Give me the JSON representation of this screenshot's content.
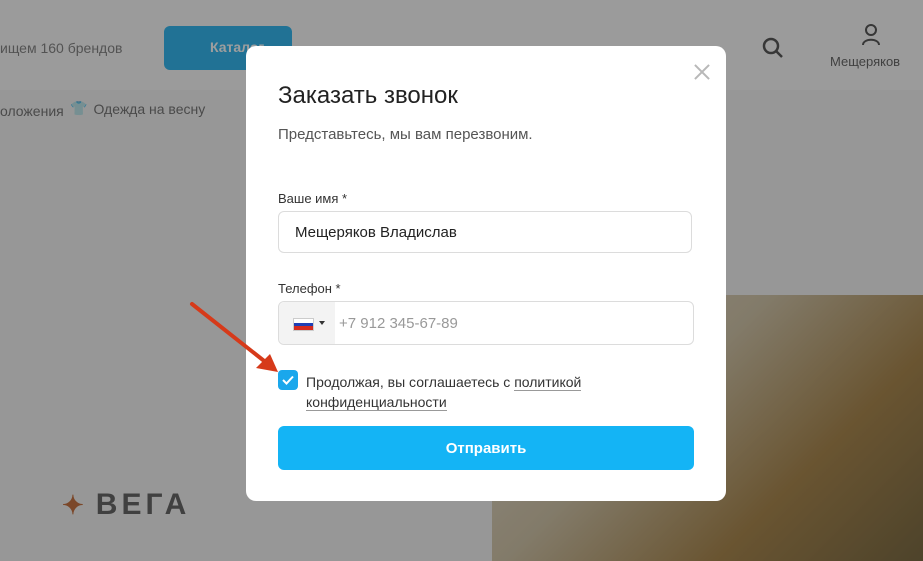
{
  "background": {
    "search_placeholder": "ищем 160 брендов",
    "catalog_button": "Каталог",
    "nav_item_1": "оложения",
    "nav_item_2": "Одежда на весну",
    "user_label": "Мещеряков",
    "logo_text": "ВЕГА"
  },
  "modal": {
    "title": "Заказать звонок",
    "subtitle": "Представьтесь, мы вам перезвоним.",
    "name_label": "Ваше имя *",
    "name_value": "Мещеряков Владислав",
    "phone_label": "Телефон *",
    "phone_placeholder": "+7 912 345-67-89",
    "phone_country": "RU",
    "consent_text": "Продолжая, вы соглашаетесь с ",
    "consent_link": "политикой конфиденциальности",
    "checkbox_checked": true,
    "submit_label": "Отправить"
  },
  "colors": {
    "accent": "#14b4f5",
    "checkbox": "#1aa7ec",
    "arrow": "#d63a1a"
  },
  "icons": [
    "close-icon",
    "check-icon",
    "flag-ru-icon",
    "chevron-down-icon",
    "search-icon",
    "user-icon"
  ]
}
